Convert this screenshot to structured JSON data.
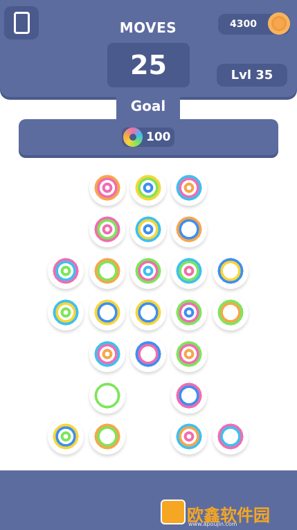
{
  "hud": {
    "moves_label": "MOVES",
    "moves_value": "25",
    "coins": "4300",
    "level": "Lvl 35",
    "goal_label": "Goal",
    "goal_count": "100"
  },
  "icons": {
    "menu": "phone-icon",
    "coin": "coin-icon",
    "goal_ring": "rainbow-ring-icon"
  },
  "colors": {
    "panel": "#5d6c9f",
    "panel_dark": "#4b5a8c",
    "orange": "#f6a64d",
    "yellow": "#f7d63a",
    "pink": "#f06db0",
    "blue": "#3f8ff0",
    "cyan": "#3ec0f0",
    "green": "#7ee55b",
    "white": "#ffffff"
  },
  "board": {
    "rings": [
      {
        "row": 0,
        "col": 1,
        "layers": [
          "orange",
          "pink",
          "white",
          "pink",
          "white"
        ]
      },
      {
        "row": 0,
        "col": 2,
        "layers": [
          "yellow",
          "green",
          "white",
          "blue",
          "white"
        ]
      },
      {
        "row": 0,
        "col": 3,
        "layers": [
          "cyan",
          "pink",
          "white",
          "orange",
          "white"
        ]
      },
      {
        "row": 1,
        "col": 1,
        "layers": [
          "pink",
          "green",
          "white",
          "pink",
          "white"
        ]
      },
      {
        "row": 1,
        "col": 2,
        "layers": [
          "cyan",
          "yellow",
          "white",
          "blue",
          "white"
        ]
      },
      {
        "row": 1,
        "col": 3,
        "layers": [
          "orange",
          "blue",
          "white",
          "white",
          "white"
        ]
      },
      {
        "row": 2,
        "col": 0,
        "layers": [
          "pink",
          "cyan",
          "white",
          "green",
          "white"
        ]
      },
      {
        "row": 2,
        "col": 1,
        "layers": [
          "orange",
          "green",
          "white",
          "white",
          "white"
        ]
      },
      {
        "row": 2,
        "col": 2,
        "layers": [
          "green",
          "pink",
          "white",
          "cyan",
          "white"
        ]
      },
      {
        "row": 2,
        "col": 3,
        "layers": [
          "cyan",
          "green",
          "white",
          "pink",
          "white"
        ]
      },
      {
        "row": 2,
        "col": 4,
        "layers": [
          "blue",
          "yellow",
          "white",
          "white",
          "white"
        ]
      },
      {
        "row": 3,
        "col": 0,
        "layers": [
          "cyan",
          "yellow",
          "white",
          "green",
          "white"
        ]
      },
      {
        "row": 3,
        "col": 1,
        "layers": [
          "yellow",
          "blue",
          "white",
          "white",
          "white"
        ]
      },
      {
        "row": 3,
        "col": 2,
        "layers": [
          "yellow",
          "blue",
          "white",
          "white",
          "white"
        ]
      },
      {
        "row": 3,
        "col": 3,
        "layers": [
          "green",
          "pink",
          "white",
          "blue",
          "white"
        ]
      },
      {
        "row": 3,
        "col": 4,
        "layers": [
          "green",
          "orange",
          "white",
          "white",
          "white"
        ]
      },
      {
        "row": 4,
        "col": 1,
        "layers": [
          "cyan",
          "pink",
          "white",
          "orange",
          "white"
        ]
      },
      {
        "row": 4,
        "col": 2,
        "layers": [
          "blue",
          "pink",
          "white",
          "white",
          "white"
        ]
      },
      {
        "row": 4,
        "col": 3,
        "layers": [
          "green",
          "pink",
          "white",
          "orange",
          "white"
        ]
      },
      {
        "row": 5,
        "col": 1,
        "layers": [
          "green",
          "white",
          "white",
          "white",
          "white"
        ]
      },
      {
        "row": 5,
        "col": 3,
        "layers": [
          "pink",
          "blue",
          "white",
          "white",
          "white"
        ]
      },
      {
        "row": 6,
        "col": 0,
        "layers": [
          "yellow",
          "blue",
          "white",
          "green",
          "white"
        ]
      },
      {
        "row": 6,
        "col": 1,
        "layers": [
          "orange",
          "green",
          "white",
          "white",
          "white"
        ]
      },
      {
        "row": 6,
        "col": 3,
        "layers": [
          "cyan",
          "orange",
          "white",
          "pink",
          "white"
        ]
      },
      {
        "row": 6,
        "col": 4,
        "layers": [
          "pink",
          "cyan",
          "white",
          "white",
          "white"
        ]
      }
    ]
  },
  "watermark": {
    "brand": "欧鑫软件园",
    "url": "www.apoujin.com"
  }
}
